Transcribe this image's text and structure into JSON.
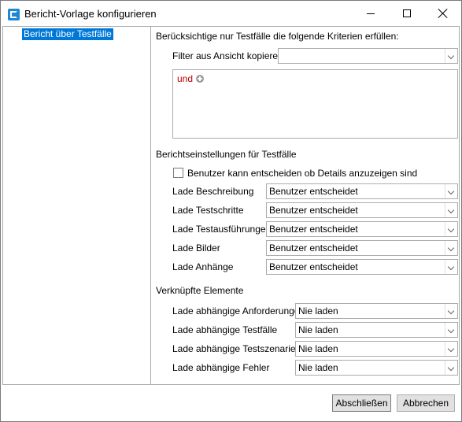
{
  "window": {
    "title": "Bericht-Vorlage konfigurieren",
    "icon": "app-icon"
  },
  "nav": {
    "items": [
      {
        "label": "Bericht über Testfälle",
        "selected": true
      }
    ]
  },
  "criteria": {
    "heading": "Berücksichtige nur Testfälle die folgende Kriterien erfüllen:",
    "copy_filter_label": "Filter aus Ansicht kopieren:",
    "copy_filter_value": "",
    "operator": "und"
  },
  "report_settings": {
    "heading": "Berichtseinstellungen für Testfälle",
    "checkbox_label": "Benutzer kann entscheiden ob Details anzuzeigen sind",
    "checkbox_checked": false,
    "rows": [
      {
        "label": "Lade Beschreibung",
        "value": "Benutzer entscheidet"
      },
      {
        "label": "Lade Testschritte",
        "value": "Benutzer entscheidet"
      },
      {
        "label": "Lade Testausführungen",
        "value": "Benutzer entscheidet"
      },
      {
        "label": "Lade Bilder",
        "value": "Benutzer entscheidet"
      },
      {
        "label": "Lade Anhänge",
        "value": "Benutzer entscheidet"
      }
    ]
  },
  "linked": {
    "heading": "Verknüpfte Elemente",
    "rows": [
      {
        "label": "Lade abhängige Anforderungen",
        "value": "Nie laden"
      },
      {
        "label": "Lade abhängige Testfälle",
        "value": "Nie laden"
      },
      {
        "label": "Lade abhängige Testszenarien",
        "value": "Nie laden"
      },
      {
        "label": "Lade abhängige Fehler",
        "value": "Nie laden"
      }
    ]
  },
  "footer": {
    "finish_label": "Abschließen",
    "cancel_label": "Abbrechen"
  },
  "colors": {
    "selection": "#0078d7",
    "operator": "#c00000"
  }
}
